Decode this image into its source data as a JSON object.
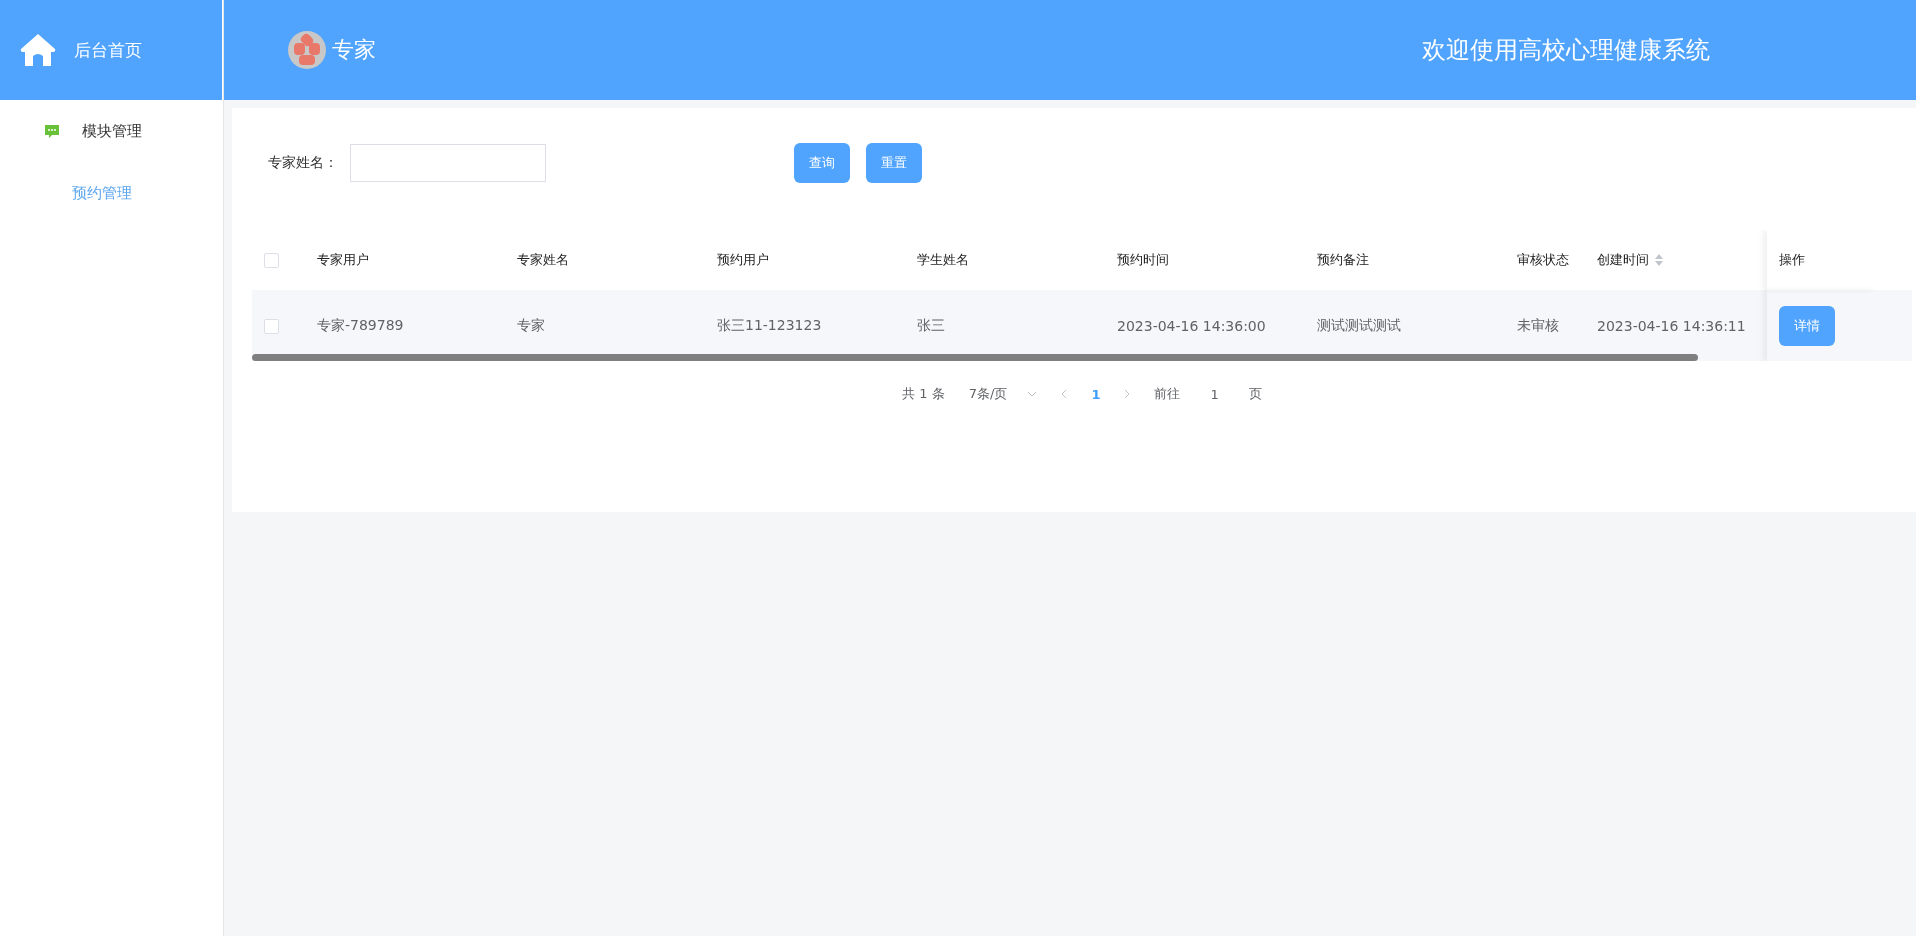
{
  "sidebar": {
    "home": "后台首页",
    "items": [
      {
        "label": "模块管理",
        "selected": false,
        "kind": "module"
      },
      {
        "label": "预约管理",
        "selected": true,
        "kind": "plain"
      }
    ]
  },
  "header": {
    "user": "专家",
    "title": "欢迎使用高校心理健康系统"
  },
  "search": {
    "label": "专家姓名：",
    "buttons": [
      "查询",
      "重置"
    ]
  },
  "table": {
    "select_all_checked": false,
    "columns": [
      "专家用户",
      "专家姓名",
      "预约用户",
      "学生姓名",
      "预约时间",
      "预约备注",
      "审核状态",
      "创建时间",
      "操作"
    ],
    "rows": [
      {
        "checked": false,
        "cells": [
          "专家-789789",
          "专家",
          "张三11-123123",
          "张三",
          "2023-04-16 14:36:00",
          "测试测试测试",
          "未审核",
          "2023-04-16 14:36:11"
        ],
        "action": "详情"
      }
    ]
  },
  "pagination": {
    "total": "共 1 条",
    "page_size": "7条/页",
    "pages": [
      {
        "label": "1",
        "selected": true
      }
    ],
    "goto_label": "前往",
    "goto_value": "1",
    "goto_suffix": "页"
  }
}
